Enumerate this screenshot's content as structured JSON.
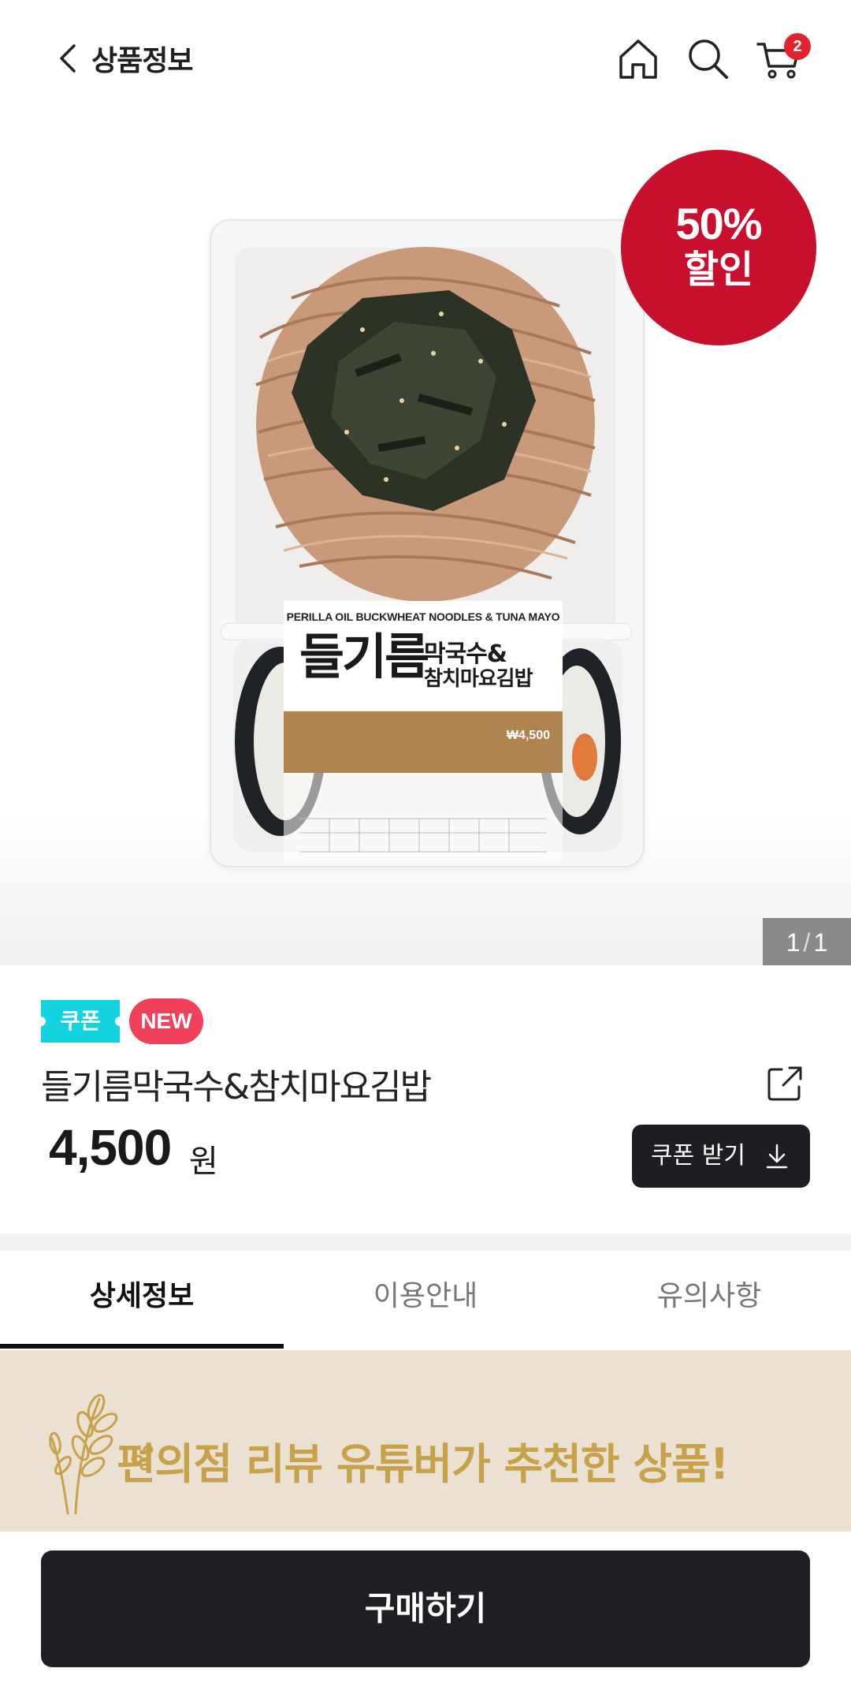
{
  "header": {
    "back_icon": "chevron-left-icon",
    "title": "상품정보",
    "home_icon": "home-icon",
    "search_icon": "search-icon",
    "cart_icon": "cart-icon",
    "cart_count": "2"
  },
  "hero": {
    "sale_percent": "50%",
    "sale_text": "할인",
    "package": {
      "english_name": "PERILLA OIL BUCKWHEAT NOODLES & TUNA MAYO",
      "korean_big": "들기름",
      "korean_sub1": "막국수&",
      "korean_sub2": "참치마요김밥",
      "price": "₩4,500"
    },
    "pager": {
      "current": "1",
      "total": "1"
    }
  },
  "product": {
    "coupon_badge": "쿠폰",
    "new_badge": "NEW",
    "name": "들기름막국수&참치마요김밥",
    "share_icon": "share-icon",
    "price": "4,500",
    "price_unit": "원",
    "coupon_button": "쿠폰 받기",
    "download_icon": "download-icon"
  },
  "tabs": [
    {
      "label": "상세정보",
      "active": true
    },
    {
      "label": "이용안내",
      "active": false
    },
    {
      "label": "유의사항",
      "active": false
    }
  ],
  "banner": {
    "text": "편의점 리뷰 유튜버가 추천한 상품!",
    "icon": "wheat-icon"
  },
  "bottom": {
    "buy_button": "구매하기"
  },
  "colors": {
    "sale_red": "#c8102e",
    "coupon_cyan": "#13d3df",
    "new_pink": "#f0405a",
    "dark_button": "#1e1f22",
    "banner_bg": "#ebe1d2",
    "banner_text": "#c8a24a"
  }
}
